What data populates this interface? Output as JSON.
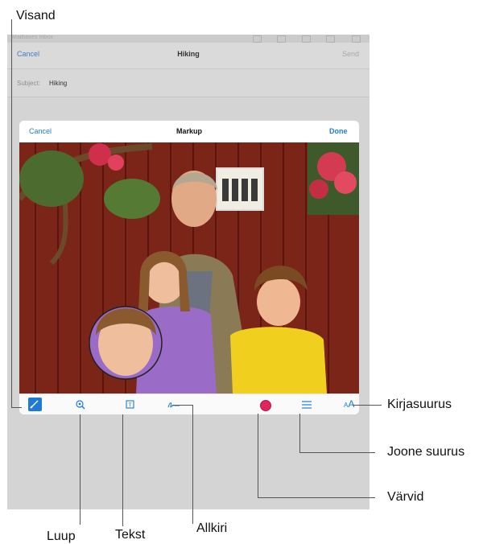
{
  "mail": {
    "topbar_text": "Mailboxes    Inbox",
    "cancel": "Cancel",
    "title": "Hiking",
    "send": "Send",
    "subject_label": "Subject:",
    "subject_value": "Hiking"
  },
  "markup": {
    "cancel": "Cancel",
    "title": "Markup",
    "done": "Done",
    "text_size_glyph": "AA",
    "selected_color": "#e0245e",
    "accent": "#1d7bd7"
  },
  "callouts": {
    "sketch": "Visand",
    "magnifier": "Luup",
    "text": "Tekst",
    "signature": "Allkiri",
    "font_size": "Kirjasuurus",
    "line_size": "Joone suurus",
    "colors": "Värvid"
  }
}
